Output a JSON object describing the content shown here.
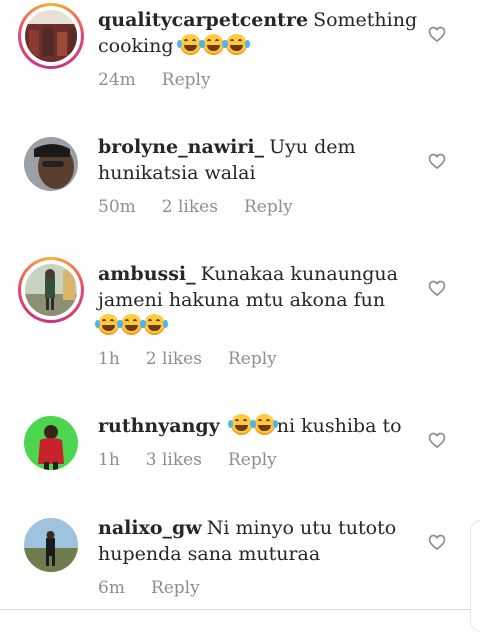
{
  "comments": [
    {
      "username": "qualitycarpetcentre",
      "text": "Something cooking",
      "emoji_count": 3,
      "time": "24m",
      "likes": "",
      "reply": "Reply",
      "has_story_ring": true,
      "avatar_color": "#7a2a2a"
    },
    {
      "username": "brolyne_nawiri_",
      "text": "Uyu dem hunikatsia walai",
      "emoji_count": 0,
      "time": "50m",
      "likes": "2 likes",
      "reply": "Reply",
      "has_story_ring": false,
      "avatar_color": "#4a3b33"
    },
    {
      "username": "ambussi_",
      "text": "Kunakaa kunaungua jameni hakuna mtu akona fun",
      "emoji_count": 3,
      "time": "1h",
      "likes": "2 likes",
      "reply": "Reply",
      "has_story_ring": true,
      "avatar_color": "#8a9a7a"
    },
    {
      "username": "ruthnyangy",
      "text_after_emoji": "ni kushiba to",
      "emoji_count": 2,
      "time": "1h",
      "likes": "3 likes",
      "reply": "Reply",
      "has_story_ring": false,
      "avatar_color": "#3bd14a"
    },
    {
      "username": "nalixo_gw",
      "text": "Ni minyo utu tutoto hupenda sana muturaa",
      "emoji_count": 0,
      "time": "6m",
      "likes": "",
      "reply": "Reply",
      "has_story_ring": false,
      "avatar_color": "#7fa6c9"
    }
  ],
  "colors": {
    "text": "#262626",
    "meta": "#8e8e8e",
    "heart": "#8e8e8e",
    "ring_start": "#f9b43a",
    "ring_end": "#c13584"
  },
  "icons": {
    "like": "heart-outline-icon",
    "emoji": "face-with-tears-of-joy-icon"
  }
}
